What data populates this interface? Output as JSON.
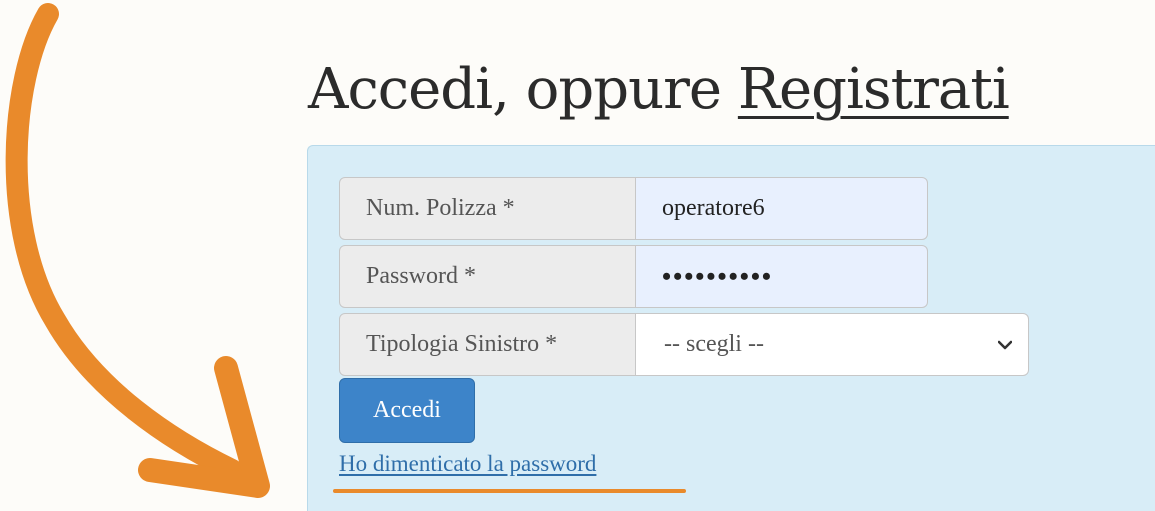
{
  "header": {
    "prefix": "Accedi, oppure ",
    "register_link": "Registrati"
  },
  "form": {
    "policy_label": "Num. Polizza *",
    "policy_value": "operatore6",
    "password_label": "Password *",
    "password_value": "••••••••••",
    "claim_type_label": "Tipologia Sinistro *",
    "claim_type_selected": "-- scegli --",
    "submit_label": "Accedi",
    "forgot_link": "Ho dimenticato la password"
  },
  "colors": {
    "annotation": "#e98a2b",
    "panel": "#d8edf7",
    "button": "#3d84c9",
    "link": "#2f6ea9"
  },
  "icons": {
    "select_arrow": "chevron-down-icon",
    "annotation_arrow": "curved-arrow-icon"
  }
}
